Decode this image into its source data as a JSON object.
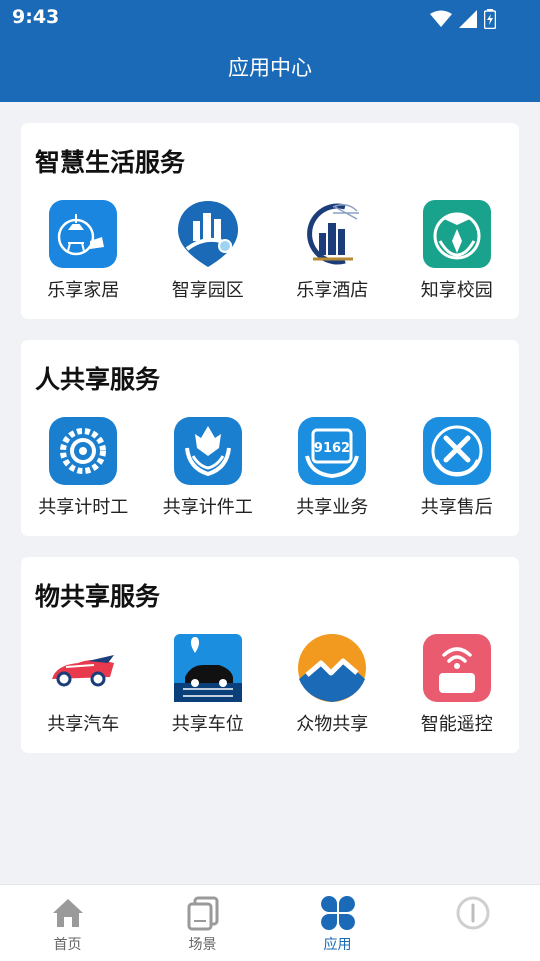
{
  "status_bar": {
    "time": "9:43"
  },
  "header": {
    "title": "应用中心"
  },
  "sections": [
    {
      "title": "智慧生活服务",
      "apps": [
        {
          "label": "乐享家居",
          "icon": "smart-home-icon"
        },
        {
          "label": "智享园区",
          "icon": "park-icon"
        },
        {
          "label": "乐享酒店",
          "icon": "hotel-icon"
        },
        {
          "label": "知享校园",
          "icon": "campus-icon"
        }
      ]
    },
    {
      "title": "人共享服务",
      "apps": [
        {
          "label": "共享计时工",
          "icon": "timed-worker-icon"
        },
        {
          "label": "共享计件工",
          "icon": "piece-worker-icon"
        },
        {
          "label": "共享业务",
          "icon": "business-icon"
        },
        {
          "label": "共享售后",
          "icon": "after-sales-icon"
        }
      ]
    },
    {
      "title": "物共享服务",
      "apps": [
        {
          "label": "共享汽车",
          "icon": "car-icon"
        },
        {
          "label": "共享车位",
          "icon": "parking-icon"
        },
        {
          "label": "众物共享",
          "icon": "mountain-icon"
        },
        {
          "label": "智能遥控",
          "icon": "remote-control-icon"
        }
      ]
    }
  ],
  "bottom_nav": [
    {
      "label": "首页",
      "icon": "home-icon"
    },
    {
      "label": "场景",
      "icon": "scene-icon"
    },
    {
      "label": "应用",
      "icon": "apps-icon",
      "active": true
    },
    {
      "label": "",
      "icon": "profile-icon"
    }
  ],
  "colors": {
    "primary": "#1b6ab7",
    "background": "#f1f2f6",
    "card": "#ffffff"
  }
}
